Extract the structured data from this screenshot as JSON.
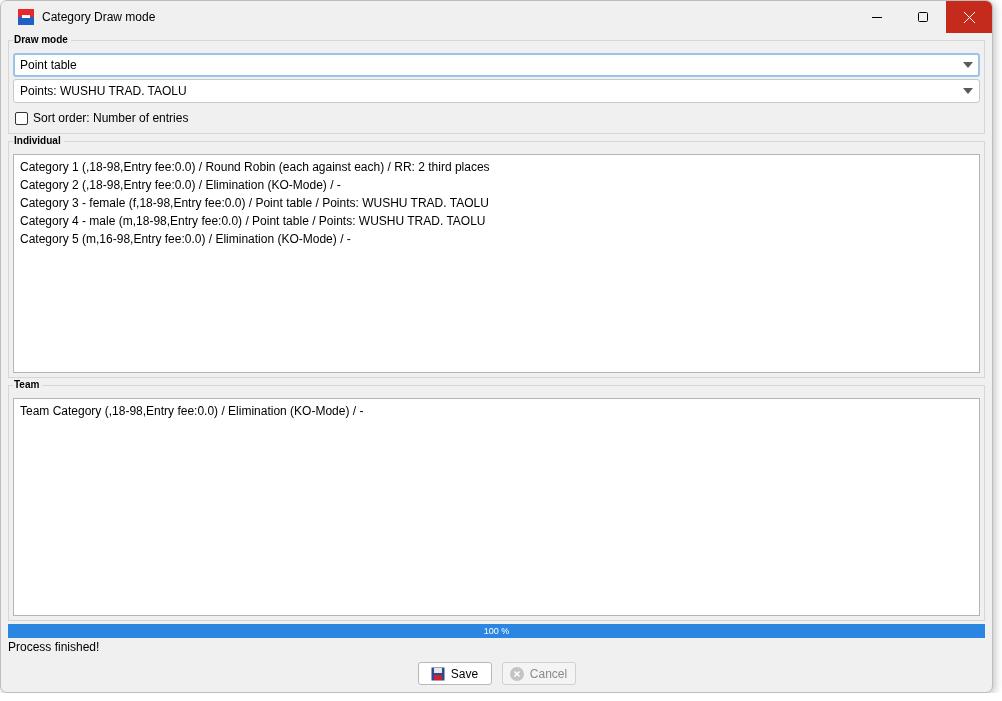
{
  "window": {
    "title": "Category Draw mode"
  },
  "draw_mode": {
    "label": "Draw mode",
    "mode_combo": {
      "value": "Point table",
      "focused": true
    },
    "points_combo": {
      "value": "Points: WUSHU TRAD. TAOLU",
      "focused": false
    },
    "sort_checkbox": {
      "label": "Sort order: Number of entries",
      "checked": false
    }
  },
  "individual": {
    "label": "Individual",
    "items": [
      "Category 1 (,18-98,Entry fee:0.0) / Round Robin (each against each) / RR: 2 third places",
      "Category 2 (,18-98,Entry fee:0.0) / Elimination (KO-Mode) / -",
      "Category 3 - female (f,18-98,Entry fee:0.0) / Point table / Points: WUSHU TRAD. TAOLU",
      "Category 4 - male (m,18-98,Entry fee:0.0) / Point table / Points: WUSHU TRAD. TAOLU",
      "Category 5 (m,16-98,Entry fee:0.0) / Elimination (KO-Mode) / -"
    ]
  },
  "team": {
    "label": "Team",
    "items": [
      "Team Category (,18-98,Entry fee:0.0) / Elimination (KO-Mode) / -"
    ]
  },
  "progress": {
    "level": 1,
    "reading": "100 %"
  },
  "status": "Process finished!",
  "buttons": [
    {
      "kind": "save",
      "label": "Save",
      "disabled": false
    },
    {
      "kind": "cancel",
      "label": "Cancel",
      "disabled": true
    }
  ]
}
